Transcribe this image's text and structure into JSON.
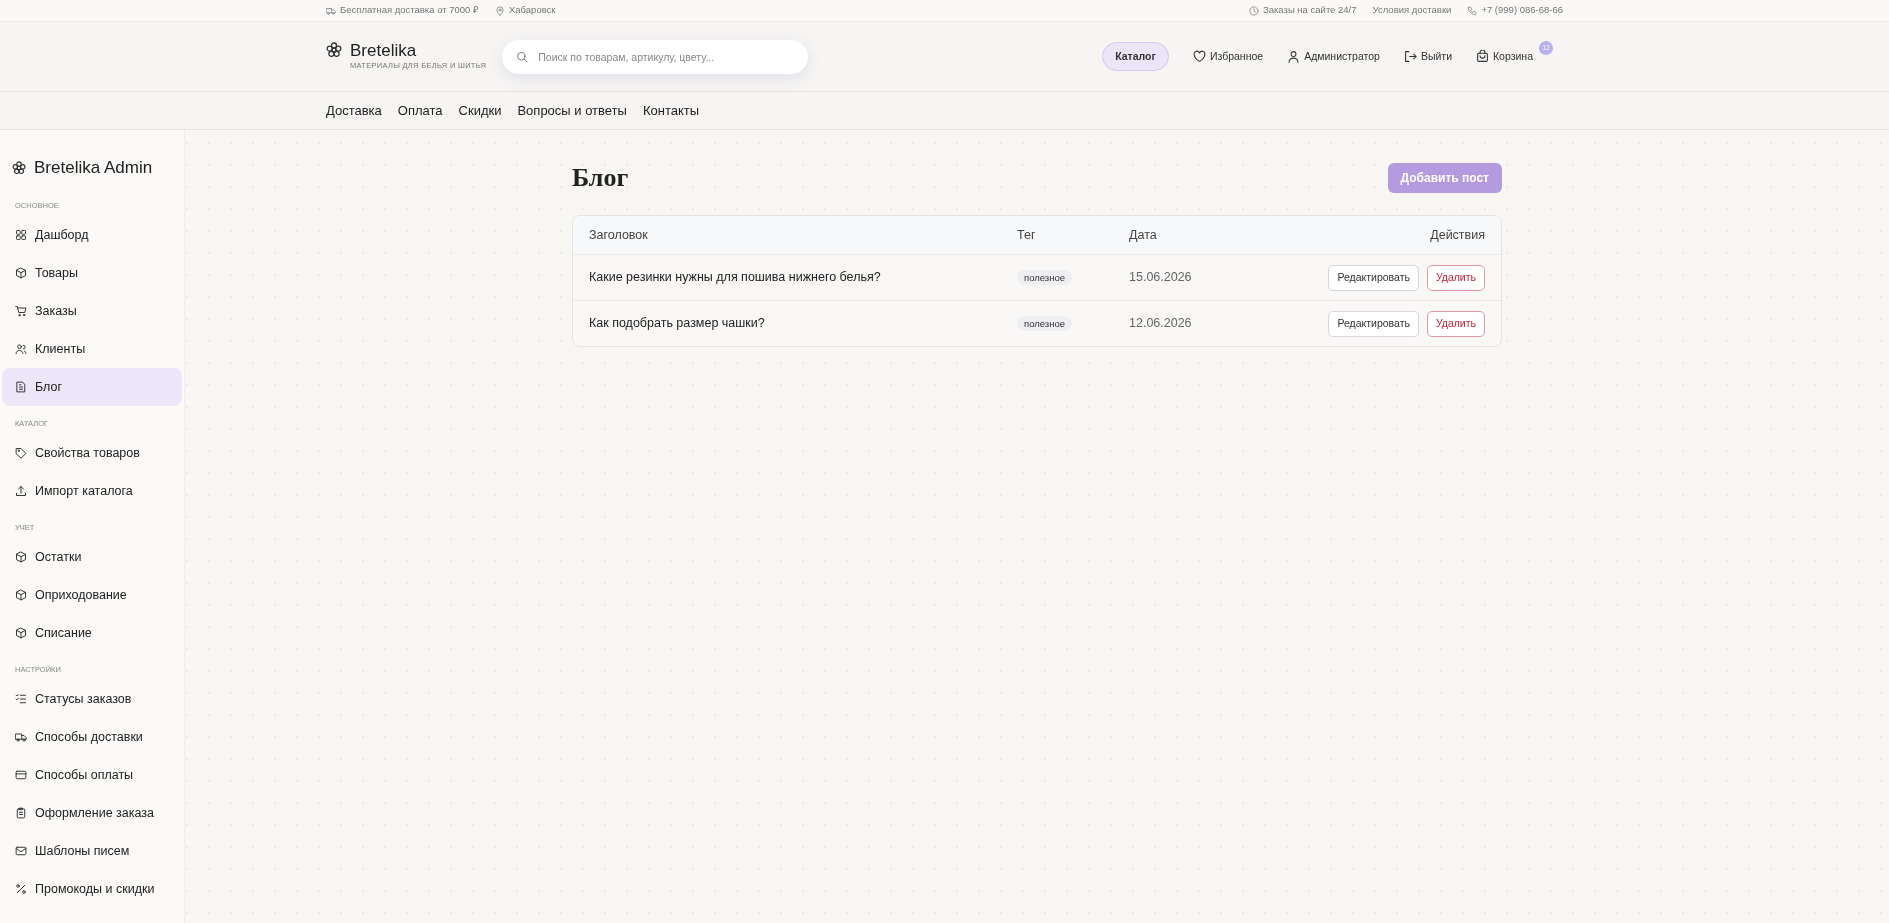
{
  "top_bar": {
    "left": [
      {
        "text": "Бесплатная доставка от 7000 ₽"
      },
      {
        "text": "Хабаровск"
      }
    ],
    "right": [
      {
        "text": "Заказы на сайте 24/7",
        "kind": "clock"
      },
      {
        "text": "Условия доставки",
        "kind": "link"
      },
      {
        "text": "+7 (999) 086-68-66",
        "kind": "phone"
      }
    ]
  },
  "header": {
    "logo": {
      "name": "Bretelika",
      "tagline": "МАТЕРИАЛЫ ДЛЯ БЕЛЬЯ И ШИТЬЯ"
    },
    "search": {
      "placeholder": "Поиск по товарам, артикулу, цвету..."
    },
    "actions": [
      {
        "label": "Каталог",
        "kind": "pill"
      },
      {
        "label": "Избранное",
        "kind": "heart"
      },
      {
        "label": "Администратор",
        "kind": "user"
      },
      {
        "label": "Выйти",
        "kind": "logout"
      },
      {
        "label": "Корзина",
        "kind": "cart",
        "badge": "12"
      }
    ]
  },
  "nav": [
    "Доставка",
    "Оплата",
    "Скидки",
    "Вопросы и ответы",
    "Контакты"
  ],
  "sidebar": {
    "title": "Bretelika Admin",
    "sections": [
      {
        "title": "ОСНОВНОЕ",
        "items": [
          {
            "label": "Дашборд",
            "selected": false
          },
          {
            "label": "Товары",
            "selected": false
          },
          {
            "label": "Заказы",
            "selected": false
          },
          {
            "label": "Клиенты",
            "selected": false
          },
          {
            "label": "Блог",
            "selected": true
          }
        ]
      },
      {
        "title": "КАТАЛОГ",
        "items": [
          {
            "label": "Свойства товаров",
            "selected": false
          },
          {
            "label": "Импорт каталога",
            "selected": false
          }
        ]
      },
      {
        "title": "УЧЕТ",
        "items": [
          {
            "label": "Остатки",
            "selected": false
          },
          {
            "label": "Оприходование",
            "selected": false
          },
          {
            "label": "Списание",
            "selected": false
          }
        ]
      },
      {
        "title": "НАСТРОЙКИ",
        "items": [
          {
            "label": "Статусы заказов",
            "selected": false
          },
          {
            "label": "Способы доставки",
            "selected": false
          },
          {
            "label": "Способы оплаты",
            "selected": false
          },
          {
            "label": "Оформление заказа",
            "selected": false
          },
          {
            "label": "Шаблоны писем",
            "selected": false
          },
          {
            "label": "Промокоды и скидки",
            "selected": false
          }
        ]
      }
    ]
  },
  "page": {
    "title": "Блог",
    "add_button": "Добавить пост",
    "table": {
      "columns": [
        "Заголовок",
        "Тег",
        "Дата",
        "Действия"
      ],
      "rows": [
        {
          "title": "Какие резинки нужны для пошива нижнего белья?",
          "tag": "полезное",
          "date": "15.06.2026",
          "actions": [
            {
              "label": "Редактировать",
              "kind": "edit"
            },
            {
              "label": "Удалить",
              "kind": "delete"
            }
          ]
        },
        {
          "title": "Как подобрать размер чашки?",
          "tag": "полезное",
          "date": "12.06.2026",
          "actions": [
            {
              "label": "Редактировать",
              "kind": "edit"
            },
            {
              "label": "Удалить",
              "kind": "delete"
            }
          ]
        }
      ]
    }
  }
}
